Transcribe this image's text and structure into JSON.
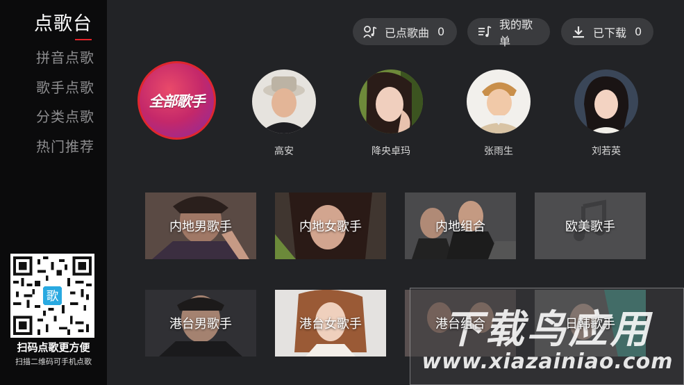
{
  "sidebar": {
    "title": "点歌台",
    "items": [
      {
        "label": "拼音点歌"
      },
      {
        "label": "歌手点歌"
      },
      {
        "label": "分类点歌"
      },
      {
        "label": "热门推荐"
      }
    ],
    "qr_badge": "歌",
    "qr_caption": "扫码点歌更方便",
    "qr_subcaption": "扫描二维码可手机点歌"
  },
  "top_bar": {
    "ordered": {
      "label": "已点歌曲",
      "count": "0",
      "icon": "singer-note-icon"
    },
    "playlist": {
      "label": "我的歌单",
      "icon": "playlist-icon"
    },
    "downloaded": {
      "label": "已下载",
      "count": "0",
      "icon": "download-icon"
    }
  },
  "singers": {
    "all_label": "全部歌手",
    "list": [
      {
        "name": "高安"
      },
      {
        "name": "降央卓玛"
      },
      {
        "name": "张雨生"
      },
      {
        "name": "刘若英"
      }
    ]
  },
  "categories": [
    {
      "label": "内地男歌手"
    },
    {
      "label": "内地女歌手"
    },
    {
      "label": "内地组合"
    },
    {
      "label": "欧美歌手"
    },
    {
      "label": "港台男歌手"
    },
    {
      "label": "港台女歌手"
    },
    {
      "label": "港台组合"
    },
    {
      "label": "日韩歌手"
    }
  ],
  "watermark": {
    "title": "下载鸟应用",
    "url": "www.xiazainiao.com"
  },
  "colors": {
    "accent": "#e8242b",
    "sidebar_bg": "#0b0b0c",
    "main_bg": "#222326",
    "pill_bg": "#3a3b3e"
  }
}
